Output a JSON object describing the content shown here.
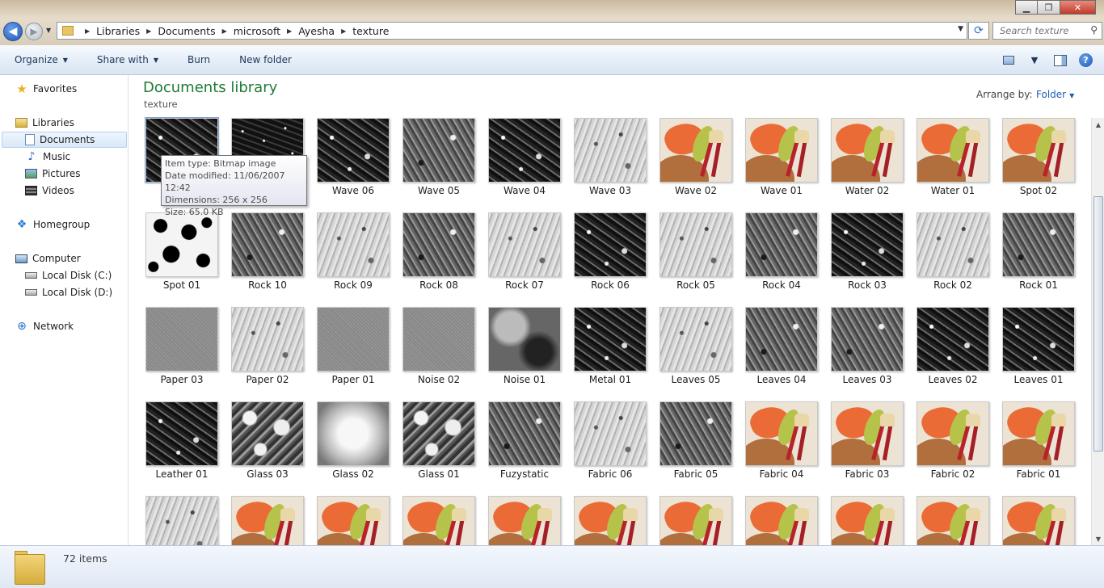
{
  "window": {
    "minimize_glyph": "▁",
    "maximize_glyph": "❐",
    "close_glyph": "✕"
  },
  "nav": {
    "back_glyph": "◀",
    "forward_glyph": "▶",
    "recent_glyph": "▼"
  },
  "address": {
    "crumbs": [
      "Libraries",
      "Documents",
      "microsoft",
      "Ayesha",
      "texture"
    ],
    "separator_glyph": "▶",
    "dropdown_glyph": "▼",
    "refresh_glyph": "⟳"
  },
  "search": {
    "placeholder": "Search texture",
    "icon_glyph": "⚲"
  },
  "toolbar": {
    "organize": "Organize",
    "share_with": "Share with",
    "burn": "Burn",
    "new_folder": "New folder",
    "caret": "▼",
    "help": "?"
  },
  "navpane": {
    "favorites": "Favorites",
    "libraries": "Libraries",
    "documents": "Documents",
    "music": "Music",
    "pictures": "Pictures",
    "videos": "Videos",
    "homegroup": "Homegroup",
    "computer": "Computer",
    "local_c": "Local Disk (C:)",
    "local_d": "Local Disk (D:)",
    "network": "Network"
  },
  "content": {
    "title": "Documents library",
    "subtitle": "texture",
    "arrange_label": "Arrange by:",
    "arrange_value": "Folder",
    "arrange_caret": "▼"
  },
  "tooltip": {
    "type": "Item type: Bitmap image",
    "modified": "Date modified: 11/06/2007 12:42",
    "dimensions": "Dimensions: 256 x 256",
    "size": "Size: 65.0 KB"
  },
  "files": [
    {
      "name": "",
      "thumb": "dark"
    },
    {
      "name": "",
      "thumb": "stars"
    },
    {
      "name": "Wave 06",
      "thumb": "dark"
    },
    {
      "name": "Wave 05",
      "thumb": "mid"
    },
    {
      "name": "Wave 04",
      "thumb": "dark"
    },
    {
      "name": "Wave 03",
      "thumb": "light"
    },
    {
      "name": "Wave 02",
      "thumb": "paint"
    },
    {
      "name": "Wave 01",
      "thumb": "paint"
    },
    {
      "name": "Water 02",
      "thumb": "paint"
    },
    {
      "name": "Water 01",
      "thumb": "paint"
    },
    {
      "name": "Spot 02",
      "thumb": "paint"
    },
    {
      "name": "Spot 01",
      "thumb": "spot"
    },
    {
      "name": "Rock 10",
      "thumb": "mid"
    },
    {
      "name": "Rock 09",
      "thumb": "light"
    },
    {
      "name": "Rock 08",
      "thumb": "mid"
    },
    {
      "name": "Rock 07",
      "thumb": "light"
    },
    {
      "name": "Rock 06",
      "thumb": "dark"
    },
    {
      "name": "Rock 05",
      "thumb": "light"
    },
    {
      "name": "Rock 04",
      "thumb": "mid"
    },
    {
      "name": "Rock 03",
      "thumb": "dark"
    },
    {
      "name": "Rock 02",
      "thumb": "light"
    },
    {
      "name": "Rock 01",
      "thumb": "mid"
    },
    {
      "name": "Paper 03",
      "thumb": "flat"
    },
    {
      "name": "Paper 02",
      "thumb": "light"
    },
    {
      "name": "Paper 01",
      "thumb": "flat"
    },
    {
      "name": "Noise 02",
      "thumb": "flat"
    },
    {
      "name": "Noise 01",
      "thumb": "soft"
    },
    {
      "name": "Metal 01",
      "thumb": "dark"
    },
    {
      "name": "Leaves 05",
      "thumb": "light"
    },
    {
      "name": "Leaves 04",
      "thumb": "mid"
    },
    {
      "name": "Leaves 03",
      "thumb": "mid"
    },
    {
      "name": "Leaves 02",
      "thumb": "dark"
    },
    {
      "name": "Leaves 01",
      "thumb": "dark"
    },
    {
      "name": "Leather 01",
      "thumb": "dark"
    },
    {
      "name": "Glass 03",
      "thumb": "glass"
    },
    {
      "name": "Glass 02",
      "thumb": "bright"
    },
    {
      "name": "Glass 01",
      "thumb": "glass"
    },
    {
      "name": "Fuzystatic",
      "thumb": "mid"
    },
    {
      "name": "Fabric 06",
      "thumb": "light"
    },
    {
      "name": "Fabric 05",
      "thumb": "mid"
    },
    {
      "name": "Fabric 04",
      "thumb": "paint"
    },
    {
      "name": "Fabric 03",
      "thumb": "paint"
    },
    {
      "name": "Fabric 02",
      "thumb": "paint"
    },
    {
      "name": "Fabric 01",
      "thumb": "paint"
    },
    {
      "name": "",
      "thumb": "light"
    },
    {
      "name": "",
      "thumb": "paint"
    },
    {
      "name": "",
      "thumb": "paint"
    },
    {
      "name": "",
      "thumb": "paint"
    },
    {
      "name": "",
      "thumb": "paint"
    },
    {
      "name": "",
      "thumb": "paint"
    },
    {
      "name": "",
      "thumb": "paint"
    },
    {
      "name": "",
      "thumb": "paint"
    },
    {
      "name": "",
      "thumb": "paint"
    },
    {
      "name": "",
      "thumb": "paint"
    },
    {
      "name": "",
      "thumb": "paint"
    }
  ],
  "status": {
    "item_count": "72 items"
  },
  "scroll": {
    "up_glyph": "▲",
    "down_glyph": "▼"
  }
}
